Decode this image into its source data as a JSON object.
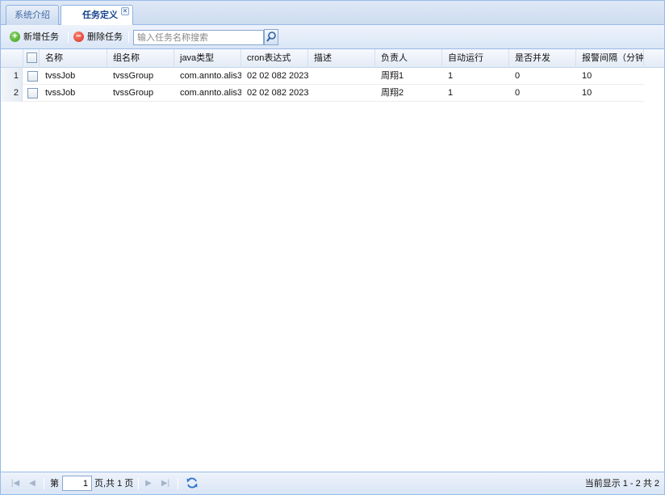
{
  "tabs": [
    {
      "label": "系统介绍",
      "active": false
    },
    {
      "label": "任务定义",
      "active": true,
      "close_icon": "close-icon"
    }
  ],
  "toolbar": {
    "add_label": "新增任务",
    "delete_label": "删除任务",
    "search_placeholder": "输入任务名称搜索",
    "search_value": ""
  },
  "grid": {
    "columns": [
      "名称",
      "组名称",
      "java类型",
      "cron表达式",
      "描述",
      "负责人",
      "自动运行",
      "是否并发",
      "报警间隔（分钟"
    ],
    "rows": [
      {
        "num": "1",
        "name": "tvssJob",
        "group": "tvssGroup",
        "java": "com.annto.alis3",
        "cron": "02 02 082 2023",
        "desc": "",
        "owner": "周翔1",
        "auto": "1",
        "concurrent": "0",
        "alarm": "10"
      },
      {
        "num": "2",
        "name": "tvssJob",
        "group": "tvssGroup",
        "java": "com.annto.alis3",
        "cron": "02 02 082 2023",
        "desc": "",
        "owner": "周翔2",
        "auto": "1",
        "concurrent": "0",
        "alarm": "10"
      }
    ]
  },
  "pager": {
    "page_prefix": "第",
    "current_page": "1",
    "page_suffix": "页,共 1 页",
    "status": "当前显示 1 - 2 共 2"
  },
  "colors": {
    "border": "#99bbe8",
    "tab_text": "#15428b",
    "add_icon": "#3c9d1f",
    "delete_icon": "#d62b1c"
  }
}
